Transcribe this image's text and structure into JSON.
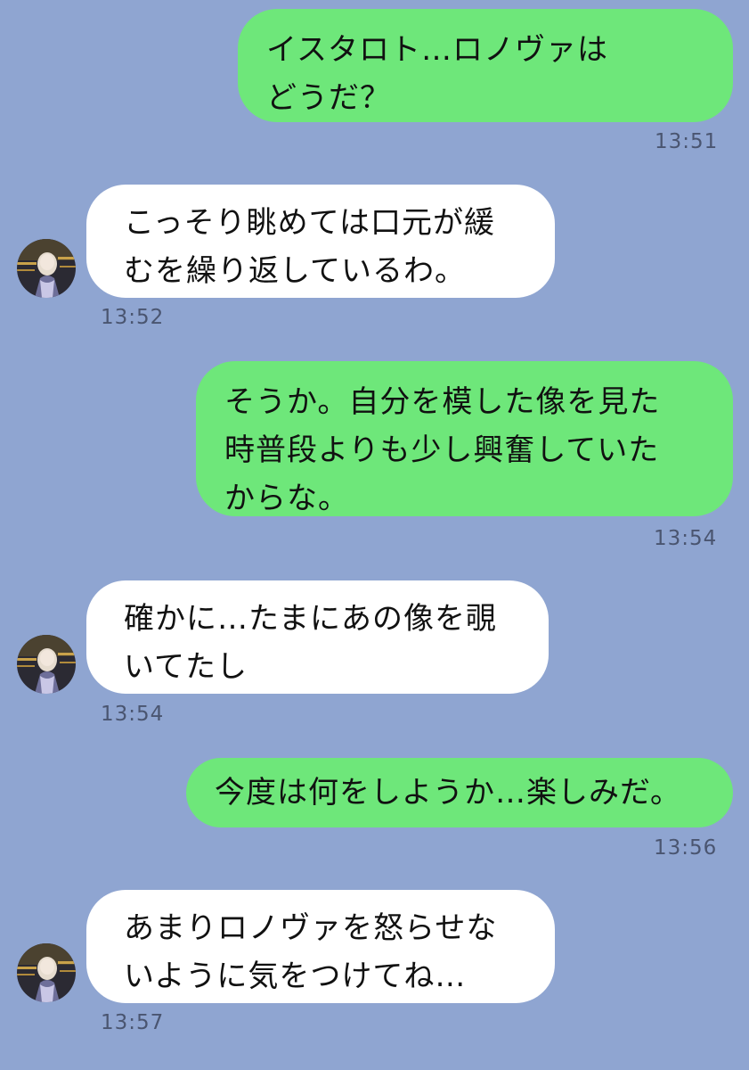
{
  "colors": {
    "background": "#8fa5d1",
    "sent_bubble": "#6ee77a",
    "received_bubble": "#ffffff",
    "timestamp": "#4a5570"
  },
  "avatar_icon": "avatar-photo-icon",
  "messages": [
    {
      "sender": "me",
      "lines": [
        "イスタロト…ロノヴァは",
        "どうだ？"
      ],
      "time": "13:51"
    },
    {
      "sender": "other",
      "lines": [
        "こっそり眺めては口元が緩",
        "むを繰り返しているわ。"
      ],
      "time": "13:52"
    },
    {
      "sender": "me",
      "lines": [
        "そうか。自分を模した像を見た",
        "時普段よりも少し興奮していた",
        "からな。"
      ],
      "time": "13:54"
    },
    {
      "sender": "other",
      "lines": [
        "確かに…たまにあの像を覗",
        "いてたし"
      ],
      "time": "13:54"
    },
    {
      "sender": "me",
      "lines": [
        "今度は何をしようか…楽しみだ。"
      ],
      "time": "13:56"
    },
    {
      "sender": "other",
      "lines": [
        "あまりロノヴァを怒らせな",
        "いように気をつけてね…"
      ],
      "time": "13:57"
    }
  ]
}
